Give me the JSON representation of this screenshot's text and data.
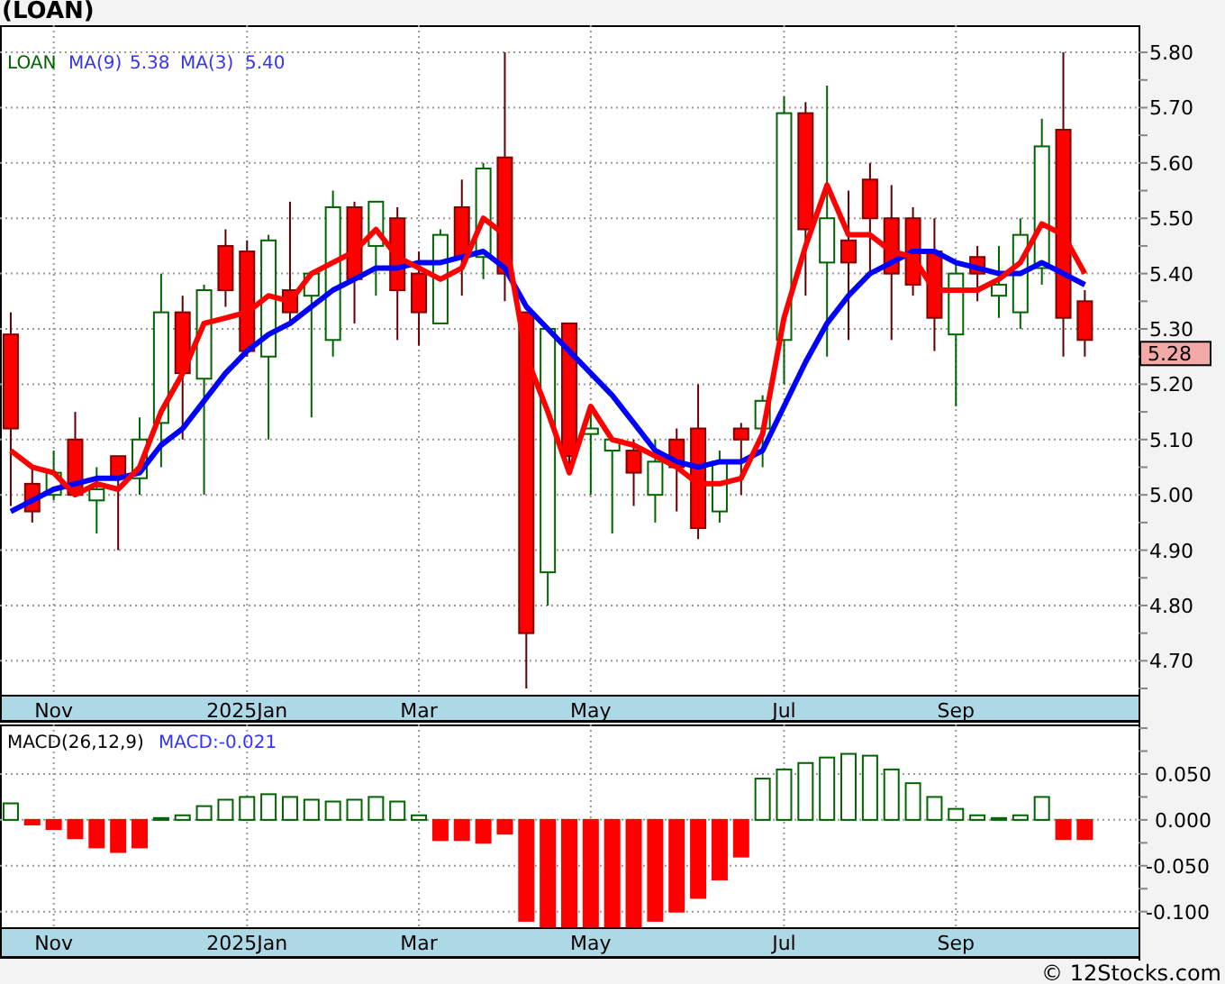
{
  "title": "(LOAN)",
  "price_panel": {
    "legend": {
      "symbol": "LOAN",
      "items": [
        {
          "label": "MA(9)",
          "value": "5.38"
        },
        {
          "label": "MA(3)",
          "value": "5.40"
        }
      ]
    },
    "last_price": "5.28",
    "chart_data": {
      "type": "candlestick",
      "grid": true,
      "categories": [
        null,
        null,
        "Nov",
        null,
        null,
        null,
        null,
        null,
        null,
        null,
        null,
        "2025Jan",
        null,
        null,
        null,
        null,
        null,
        null,
        null,
        "Mar",
        null,
        null,
        null,
        null,
        null,
        null,
        null,
        "May",
        null,
        null,
        null,
        null,
        null,
        null,
        null,
        null,
        "Jul",
        null,
        null,
        null,
        null,
        null,
        null,
        null,
        "Sep",
        null,
        null,
        null,
        null,
        null,
        null,
        null,
        null
      ],
      "ylim": [
        4.637,
        5.849
      ],
      "yticks": [
        {
          "value": 5.8,
          "label": "5.80"
        },
        {
          "value": 5.7,
          "label": "5.70"
        },
        {
          "value": 5.6,
          "label": "5.60"
        },
        {
          "value": 5.5,
          "label": "5.50"
        },
        {
          "value": 5.4,
          "label": "5.40"
        },
        {
          "value": 5.3,
          "label": "5.30"
        },
        {
          "value": 5.2,
          "label": "5.20"
        },
        {
          "value": 5.1,
          "label": "5.10"
        },
        {
          "value": 5.0,
          "label": "5.00"
        },
        {
          "value": 4.9,
          "label": "4.90"
        },
        {
          "value": 4.8,
          "label": "4.80"
        },
        {
          "value": 4.7,
          "label": "4.70"
        }
      ],
      "ohlc": [
        [
          5.29,
          5.33,
          4.98,
          5.12
        ],
        [
          5.02,
          5.05,
          4.95,
          4.97
        ],
        [
          5.0,
          5.08,
          4.99,
          5.04
        ],
        [
          5.1,
          5.15,
          5.0,
          5.0
        ],
        [
          4.99,
          5.05,
          4.93,
          5.01
        ],
        [
          5.07,
          5.07,
          4.9,
          5.03
        ],
        [
          5.03,
          5.14,
          5.0,
          5.1
        ],
        [
          5.13,
          5.4,
          5.05,
          5.33
        ],
        [
          5.33,
          5.36,
          5.1,
          5.22
        ],
        [
          5.21,
          5.38,
          5.0,
          5.37
        ],
        [
          5.45,
          5.48,
          5.34,
          5.37
        ],
        [
          5.44,
          5.46,
          5.25,
          5.26
        ],
        [
          5.25,
          5.47,
          5.1,
          5.46
        ],
        [
          5.37,
          5.53,
          5.31,
          5.33
        ],
        [
          5.36,
          5.4,
          5.14,
          5.4
        ],
        [
          5.28,
          5.55,
          5.25,
          5.52
        ],
        [
          5.52,
          5.53,
          5.31,
          5.39
        ],
        [
          5.45,
          5.53,
          5.36,
          5.53
        ],
        [
          5.5,
          5.52,
          5.28,
          5.37
        ],
        [
          5.4,
          5.44,
          5.27,
          5.33
        ],
        [
          5.31,
          5.48,
          5.31,
          5.47
        ],
        [
          5.52,
          5.57,
          5.36,
          5.43
        ],
        [
          5.43,
          5.6,
          5.39,
          5.59
        ],
        [
          5.61,
          5.8,
          5.35,
          5.4
        ],
        [
          5.33,
          5.33,
          4.65,
          4.75
        ],
        [
          4.86,
          5.3,
          4.8,
          5.3
        ],
        [
          5.31,
          5.31,
          5.05,
          5.07
        ],
        [
          5.11,
          5.15,
          5.0,
          5.12
        ],
        [
          5.08,
          5.1,
          4.93,
          5.1
        ],
        [
          5.08,
          5.1,
          4.98,
          5.04
        ],
        [
          5.0,
          5.1,
          4.95,
          5.06
        ],
        [
          5.1,
          5.12,
          4.97,
          5.05
        ],
        [
          5.12,
          5.2,
          4.92,
          4.94
        ],
        [
          4.97,
          5.08,
          4.95,
          5.06
        ],
        [
          5.12,
          5.13,
          5.0,
          5.1
        ],
        [
          5.12,
          5.18,
          5.05,
          5.17
        ],
        [
          5.28,
          5.72,
          5.2,
          5.69
        ],
        [
          5.69,
          5.71,
          5.36,
          5.48
        ],
        [
          5.42,
          5.74,
          5.25,
          5.5
        ],
        [
          5.46,
          5.55,
          5.28,
          5.42
        ],
        [
          5.57,
          5.6,
          5.4,
          5.5
        ],
        [
          5.5,
          5.56,
          5.28,
          5.4
        ],
        [
          5.5,
          5.52,
          5.36,
          5.38
        ],
        [
          5.44,
          5.5,
          5.26,
          5.32
        ],
        [
          5.29,
          5.42,
          5.16,
          5.4
        ],
        [
          5.43,
          5.45,
          5.35,
          5.4
        ],
        [
          5.36,
          5.45,
          5.32,
          5.38
        ],
        [
          5.33,
          5.5,
          5.3,
          5.47
        ],
        [
          5.41,
          5.68,
          5.38,
          5.63
        ],
        [
          5.66,
          5.8,
          5.25,
          5.32
        ],
        [
          5.35,
          5.37,
          5.25,
          5.28
        ],
        null,
        null
      ],
      "series": [
        {
          "type": "line",
          "color": "#0000ff",
          "values": [
            4.97,
            4.99,
            5.01,
            5.02,
            5.03,
            5.03,
            5.04,
            5.09,
            5.12,
            5.17,
            5.22,
            5.26,
            5.29,
            5.31,
            5.34,
            5.37,
            5.39,
            5.41,
            5.41,
            5.42,
            5.42,
            5.43,
            5.44,
            5.41,
            5.34,
            5.3,
            5.26,
            5.22,
            5.18,
            5.13,
            5.08,
            5.06,
            5.05,
            5.06,
            5.06,
            5.08,
            5.16,
            5.24,
            5.31,
            5.36,
            5.4,
            5.42,
            5.44,
            5.44,
            5.42,
            5.41,
            5.4,
            5.4,
            5.42,
            5.4,
            5.38,
            null,
            null
          ]
        },
        {
          "type": "line",
          "color": "#ff0000",
          "values": [
            5.08,
            5.05,
            5.04,
            5.0,
            5.02,
            5.01,
            5.05,
            5.15,
            5.22,
            5.31,
            5.32,
            5.33,
            5.36,
            5.35,
            5.4,
            5.42,
            5.44,
            5.48,
            5.43,
            5.41,
            5.39,
            5.41,
            5.5,
            5.47,
            5.25,
            5.15,
            5.04,
            5.16,
            5.1,
            5.09,
            5.07,
            5.05,
            5.02,
            5.02,
            5.03,
            5.11,
            5.32,
            5.45,
            5.56,
            5.47,
            5.47,
            5.44,
            5.43,
            5.37,
            5.37,
            5.37,
            5.39,
            5.42,
            5.49,
            5.47,
            5.4,
            null,
            null
          ]
        }
      ]
    }
  },
  "macd_panel": {
    "legend": {
      "label": "MACD(26,12,9)",
      "value": "MACD:-0.021"
    },
    "chart_data": {
      "type": "bar",
      "grid": true,
      "categories": [
        null,
        null,
        "Nov",
        null,
        null,
        null,
        null,
        null,
        null,
        null,
        null,
        "2025Jan",
        null,
        null,
        null,
        null,
        null,
        null,
        null,
        "Mar",
        null,
        null,
        null,
        null,
        null,
        null,
        null,
        "May",
        null,
        null,
        null,
        null,
        null,
        null,
        null,
        null,
        "Jul",
        null,
        null,
        null,
        null,
        null,
        null,
        null,
        "Sep",
        null,
        null,
        null,
        null,
        null,
        null,
        null,
        null
      ],
      "ylim": [
        -0.118,
        0.104
      ],
      "yticks": [
        {
          "value": 0.05,
          "label": "0.050"
        },
        {
          "value": 0,
          "label": "0.000"
        },
        {
          "value": -0.05,
          "label": "-0.050"
        },
        {
          "value": -0.1,
          "label": "-0.100"
        }
      ],
      "series": [
        {
          "color": "#006400",
          "values": [
            0.018,
            null,
            null,
            null,
            null,
            null,
            null,
            0.002,
            0.005,
            0.015,
            0.022,
            0.025,
            0.028,
            0.025,
            0.022,
            0.02,
            0.022,
            0.025,
            0.02,
            0.005,
            null,
            null,
            null,
            null,
            null,
            null,
            null,
            null,
            null,
            null,
            null,
            null,
            null,
            null,
            null,
            0.045,
            0.055,
            0.062,
            0.068,
            0.072,
            0.07,
            0.055,
            0.04,
            0.025,
            0.012,
            0.005,
            0.002,
            0.005,
            0.025,
            null,
            null,
            null,
            null
          ]
        },
        {
          "color": "#ff0000",
          "values": [
            null,
            -0.005,
            -0.01,
            -0.02,
            -0.03,
            -0.035,
            -0.03,
            null,
            null,
            null,
            null,
            null,
            null,
            null,
            null,
            null,
            null,
            null,
            null,
            null,
            -0.022,
            -0.022,
            -0.025,
            -0.015,
            -0.11,
            -0.117,
            -0.117,
            -0.117,
            -0.117,
            -0.117,
            -0.11,
            -0.1,
            -0.085,
            -0.065,
            -0.04,
            null,
            null,
            null,
            null,
            null,
            null,
            null,
            null,
            null,
            null,
            null,
            null,
            null,
            null,
            -0.021,
            -0.021,
            null,
            null
          ]
        }
      ]
    }
  },
  "copyright": "© 12Stocks.com"
}
